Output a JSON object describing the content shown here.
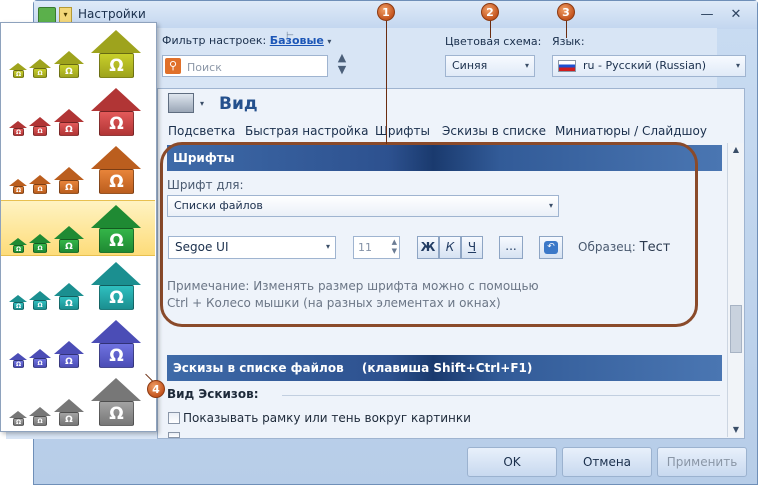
{
  "window": {
    "title": "Настройки",
    "quick_access_glyph": "▾",
    "minimize_glyph": "—",
    "close_glyph": "✕"
  },
  "toolbar": {
    "filter_label": "Фильтр настроек:",
    "filter_value": "Базовые",
    "filter_arrow": "▾",
    "pin_glyph": "⊢",
    "search_placeholder": "Поиск",
    "search_icon_glyph": "⚲",
    "updown_glyph": "▲\n▼",
    "color_scheme_label": "Цветовая схема:",
    "color_scheme_value": "Синяя",
    "language_label": "Язык:",
    "language_value": "ru - Русский (Russian)"
  },
  "section": {
    "title": "Вид",
    "nav": [
      "Подсветка",
      "Быстрая настройка",
      "Шрифты",
      "Эскизы в списке",
      "Миниатюры / Слайдшоу"
    ]
  },
  "fonts": {
    "header": "Шрифты",
    "font_for_label": "Шрифт для:",
    "font_for_value": "Списки файлов",
    "font_name": "Segoe UI",
    "font_size": "11",
    "bold": "Ж",
    "italic": "К",
    "underline": "Ч",
    "more": "...",
    "sample_label": "Образец:",
    "sample_value": "Тест",
    "note_line1": "Примечание: Изменять размер шрифта можно с помощью",
    "note_line2": "Ctrl + Колесо мышки (на разных элементах и окнах)"
  },
  "thumbnails": {
    "header": "Эскизы в списке файлов",
    "hotkey": "(клавиша Shift+Ctrl+F1)",
    "type_label": "Вид Эскизов:",
    "show_frame_label": "Показывать рамку или тень вокруг картинки"
  },
  "markers": [
    "1",
    "2",
    "3",
    "4"
  ],
  "buttons": {
    "ok": "OK",
    "cancel": "Отмена",
    "apply": "Применить"
  },
  "scroll": {
    "up_glyph": "▲",
    "down_glyph": "▼"
  },
  "icon_themes": [
    {
      "color": "#c8cf2a",
      "roof": "#9ea31d"
    },
    {
      "color": "#e35a5a",
      "roof": "#b13535"
    },
    {
      "color": "#e8843a",
      "roof": "#bb5e1e"
    },
    {
      "color": "#34b548",
      "roof": "#1f8a33"
    },
    {
      "color": "#2fbfbf",
      "roof": "#1b8f90"
    },
    {
      "color": "#6f72e0",
      "roof": "#4b4db6"
    },
    {
      "color": "#a3a3a3",
      "roof": "#777777"
    }
  ],
  "icon_glyph": "Ω",
  "selected_theme": 3
}
